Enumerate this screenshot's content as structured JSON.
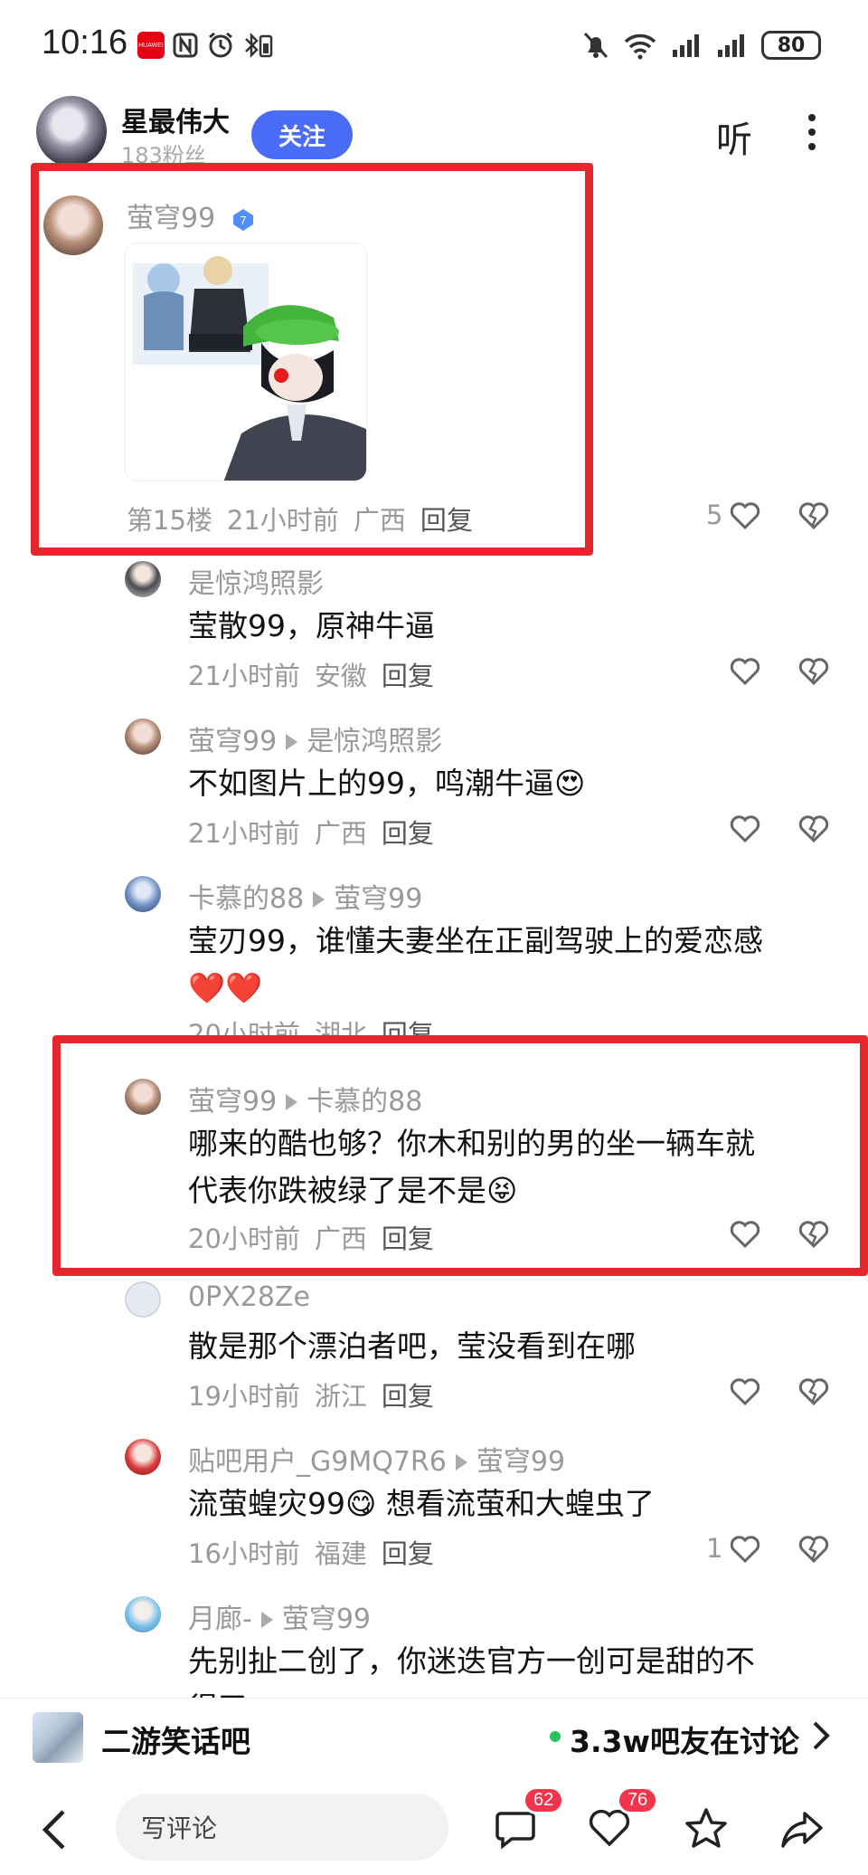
{
  "status_bar": {
    "time": "10:16",
    "battery": "80",
    "huawei_label": "HUAWEI"
  },
  "header": {
    "username": "星最伟大",
    "fans": "183粉丝",
    "follow_label": "关注",
    "listen_label": "听"
  },
  "main_comment": {
    "username": "萤穹99",
    "level": "7",
    "floor": "第15楼",
    "time": "21小时前",
    "location": "广西",
    "reply_label": "回复",
    "likes": "5"
  },
  "replies": [
    {
      "username": "是惊鸿照影",
      "target": "",
      "text": "莹散99，原神牛逼",
      "time": "21小时前",
      "location": "安徽",
      "reply_label": "回复",
      "likes": ""
    },
    {
      "username": "萤穹99",
      "target": "是惊鸿照影",
      "text": "不如图片上的99，鸣潮牛逼",
      "emoji": "😍",
      "time": "21小时前",
      "location": "广西",
      "reply_label": "回复",
      "likes": ""
    },
    {
      "username": "卡慕的88",
      "target": "萤穹99",
      "text": "莹刃99，谁懂夫妻坐在正副驾驶上的爱恋感",
      "text2": "❤️❤️",
      "time": "20小时前",
      "location": "湖北",
      "reply_label": "回复",
      "likes": ""
    },
    {
      "username": "萤穹99",
      "target": "卡慕的88",
      "text": "哪来的酷也够？你木和别的男的坐一辆车就",
      "text2": "代表你跌被绿了是不是",
      "emoji": "😝",
      "time": "20小时前",
      "location": "广西",
      "reply_label": "回复",
      "likes": ""
    },
    {
      "username": "0PX28Ze",
      "target": "",
      "text": "散是那个漂泊者吧，莹没看到在哪",
      "time": "19小时前",
      "location": "浙江",
      "reply_label": "回复",
      "likes": ""
    },
    {
      "username": "贴吧用户_G9MQ7R6",
      "target": "萤穹99",
      "text": "流萤蝗灾99",
      "emoji": "😋",
      "text_after": " 想看流萤和大蝗虫了",
      "time": "16小时前",
      "location": "福建",
      "reply_label": "回复",
      "likes": "1"
    },
    {
      "username": "月廊-",
      "target": "萤穹99",
      "text": "先别扯二创了，你迷迭官方一创可是甜的不",
      "text2": "得了",
      "time": "",
      "location": "",
      "reply_label": "",
      "likes": ""
    }
  ],
  "forum": {
    "name": "二游笑话吧",
    "stat": "3.3w吧友在讨论"
  },
  "toolbar": {
    "write_placeholder": "写评论",
    "comment_count": "62",
    "like_count": "76"
  },
  "colors": {
    "accent": "#4a6cf7",
    "highlight_frame": "#e6262d",
    "badge": "#f5334a",
    "online_dot": "#25c35e"
  }
}
